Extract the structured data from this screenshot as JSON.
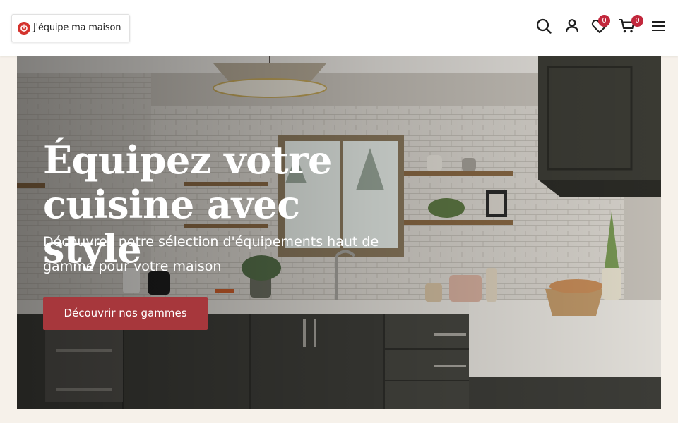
{
  "header": {
    "logo_text": "J'équipe ma maison",
    "icons": {
      "search": "search-icon",
      "account": "user-icon",
      "wishlist": "heart-icon",
      "cart": "cart-icon",
      "menu": "hamburger-menu-icon"
    },
    "wishlist_count": "0",
    "cart_count": "0",
    "badge_color": "#c2273c"
  },
  "hero": {
    "title_line1": "Équipez votre",
    "title_line2": "cuisine avec style",
    "subtitle": "Découvrez notre sélection d'équipements haut de gamme pour votre maison",
    "cta_label": "Découvrir nos gammes",
    "cta_color": "#a7373c"
  }
}
